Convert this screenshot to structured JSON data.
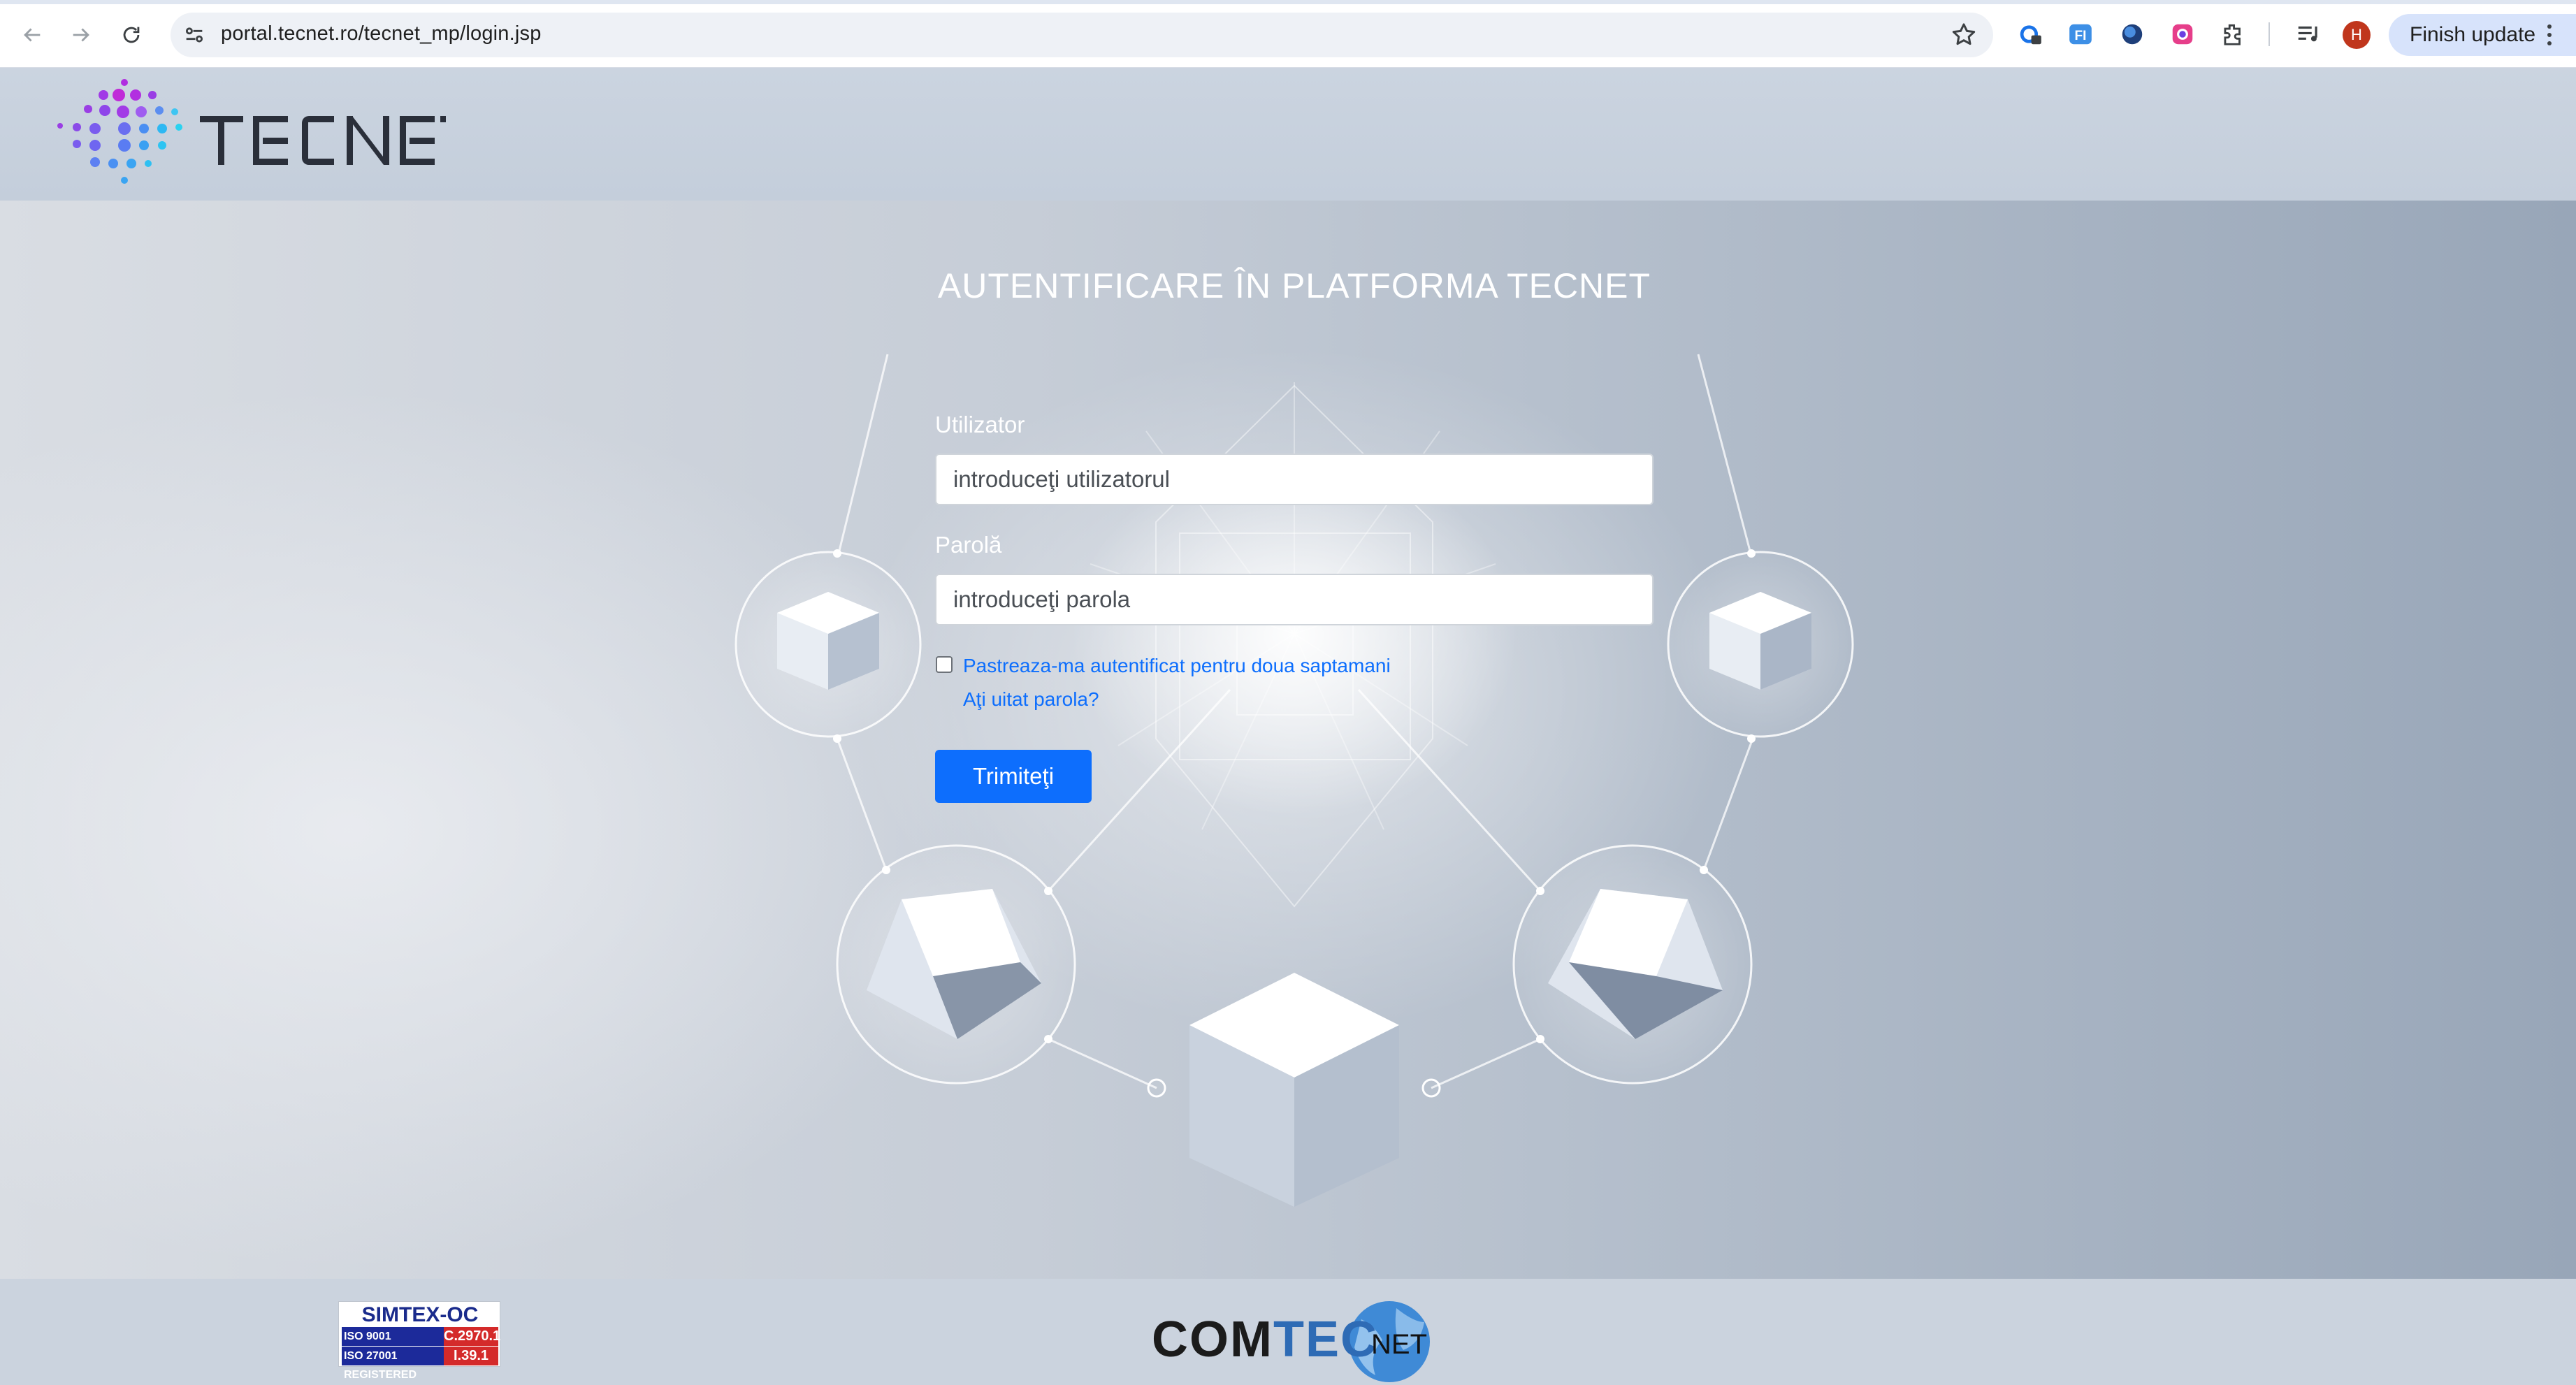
{
  "browser": {
    "url": "portal.tecnet.ro/tecnet_mp/login.jsp",
    "profile_initial": "H",
    "finish_update_label": "Finish update"
  },
  "header": {
    "logo_text": "TECNET"
  },
  "login": {
    "title": "AUTENTIFICARE ÎN PLATFORMA TECNET",
    "username_label": "Utilizator",
    "username_placeholder": "introduceţi utilizatorul",
    "password_label": "Parolă",
    "password_placeholder": "introduceţi parola",
    "remember_label": "Pastreaza-ma autentificat pentru doua saptamani",
    "forgot_label": "Aţi uitat parola?",
    "submit_label": "Trimiteţi",
    "remember_checked": false
  },
  "footer": {
    "simtex_title": "SIMTEX-OC",
    "simtex_iso1": "ISO 9001 REGISTERED",
    "simtex_code1": "C.2970.1",
    "simtex_iso2": "ISO 27001 REGISTERED",
    "simtex_code2": "I.39.1",
    "comtec_main": "COM",
    "comtec_tec": "TEC",
    "comtec_net": "NET"
  },
  "colors": {
    "primary": "#0d6efd",
    "tecnet_purple": "#9b2fe0",
    "tecnet_blue": "#2aa4f0"
  }
}
